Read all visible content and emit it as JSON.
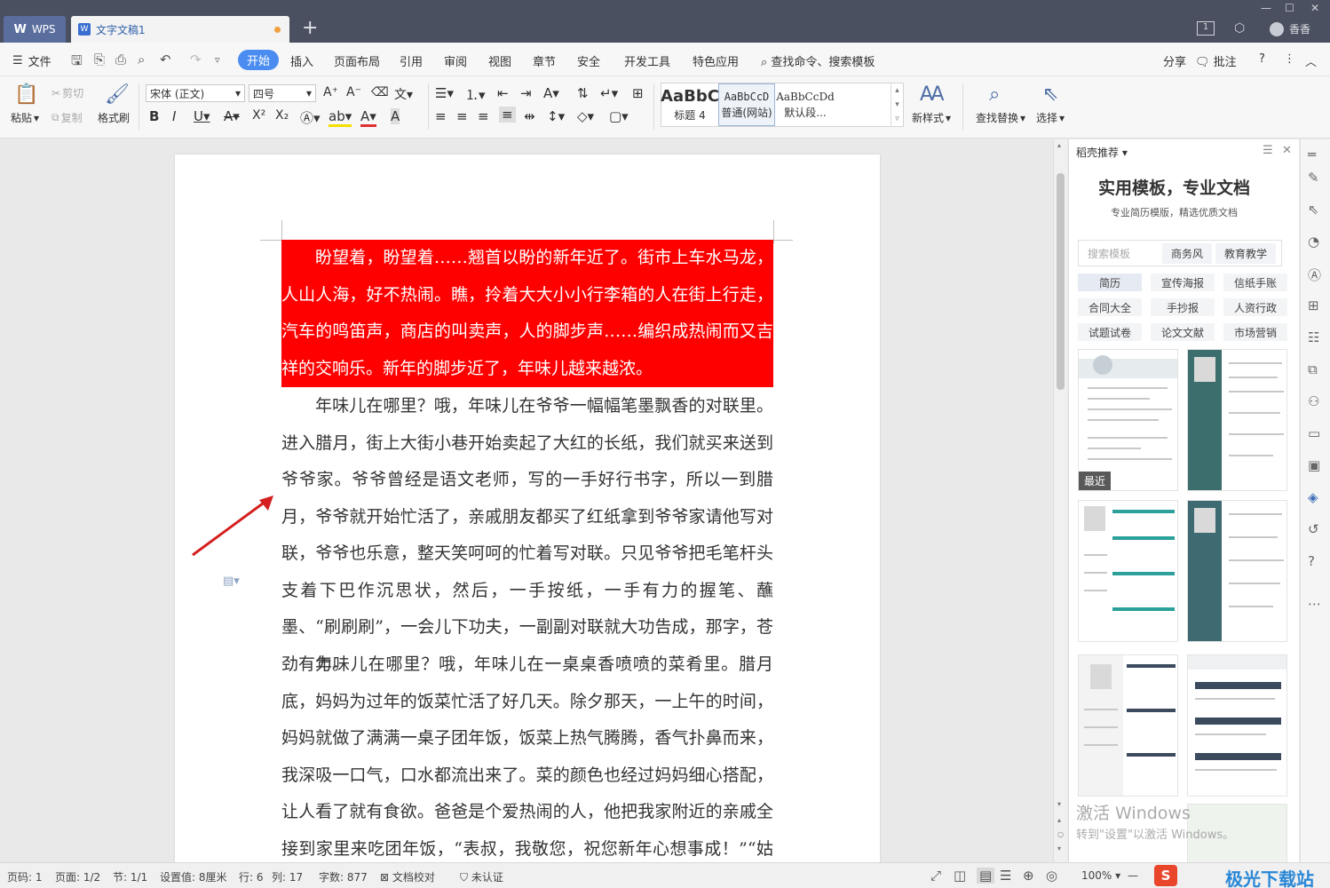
{
  "titlebar": {
    "app_tab": "WPS",
    "doc_tab": "文字文稿1",
    "new_tab": "+",
    "user_name": "香香"
  },
  "menubar": {
    "file": "文件",
    "tabs": [
      "开始",
      "插入",
      "页面布局",
      "引用",
      "审阅",
      "视图",
      "章节",
      "安全",
      "开发工具",
      "特色应用"
    ],
    "search": "查找命令、搜索模板",
    "share": "分享",
    "comment": "批注"
  },
  "ribbon": {
    "paste": "粘贴",
    "cut": "剪切",
    "copy": "复制",
    "format_painter": "格式刷",
    "font": "宋体 (正文)",
    "size": "四号",
    "styles": [
      {
        "sample": "AaBbC",
        "name": "标题 4"
      },
      {
        "sample": "AaBbCcD",
        "name": "普通(网站)"
      },
      {
        "sample": "AaBbCcDd",
        "name": "默认段..."
      }
    ],
    "new_style": "新样式",
    "find_replace": "查找替换",
    "select": "选择"
  },
  "document": {
    "paragraphs": [
      "盼望着，盼望着……翘首以盼的新年近了。街市上车水马龙，人山人海，好不热闹。瞧，拎着大大小小行李箱的人在街上行走，汽车的鸣笛声，商店的叫卖声，人的脚步声……编织成热闹而又吉祥的交响乐。新年的脚步近了，年味儿越来越浓。",
      "年味儿在哪里？哦，年味儿在爷爷一幅幅笔墨飘香的对联里。进入腊月，街上大街小巷开始卖起了大红的长纸，我们就买来送到爷爷家。爷爷曾经是语文老师，写的一手好行书字，所以一到腊月，爷爷就开始忙活了，亲戚朋友都买了红纸拿到爷爷家请他写对联，爷爷也乐意，整天笑呵呵的忙着写对联。只见爷爷把毛笔杆头支着下巴作沉思状，然后，一手按纸，一手有力的握笔、蘸墨、“刷刷刷”，一会儿下功夫，一副副对联就大功告成，那字，苍劲有力。",
      "年味儿在哪里？哦，年味儿在一桌桌香喷喷的菜肴里。腊月底，妈妈为过年的饭菜忙活了好几天。除夕那天，一上午的时间，妈妈就做了满满一桌子团年饭，饭菜上热气腾腾，香气扑鼻而来，我深吸一口气，口水都流出来了。菜的颜色也经过妈妈细心搭配，让人看了就有食欲。爸爸是个爱热闹的人，他把我家附近的亲戚全接到家里来吃团年饭，“表叔，我敬您，祝您新年心想事成！”“姑姑，我敬您，祝"
    ],
    "highlight_color": "#ff0000"
  },
  "sidepanel": {
    "header": "稻壳推荐",
    "title": "实用模板，专业文档",
    "subtitle": "专业简历模版，精选优质文档",
    "search_placeholder": "搜索模板",
    "search_tags": [
      "商务风",
      "教育教学"
    ],
    "categories": [
      "简历",
      "宣传海报",
      "信纸手账",
      "合同大全",
      "手抄报",
      "人资行政",
      "试题试卷",
      "论文文献",
      "市场营销"
    ],
    "recent_label": "最近",
    "watermark_1": "激活 Windows",
    "watermark_2": "转到\"设置\"以激活 Windows。"
  },
  "statusbar": {
    "page_no": "页码: 1",
    "pages": "页面: 1/2",
    "section": "节: 1/1",
    "setting": "设置值: 8厘米",
    "row": "行: 6",
    "col": "列: 17",
    "word_count": "字数: 877",
    "proofread": "文档校对",
    "cert": "未认证",
    "zoom": "100%",
    "brand": "极光下载站"
  },
  "colors": {
    "accent": "#4a8cf0",
    "titlebar": "#4b5060",
    "highlight": "#ff0000"
  }
}
